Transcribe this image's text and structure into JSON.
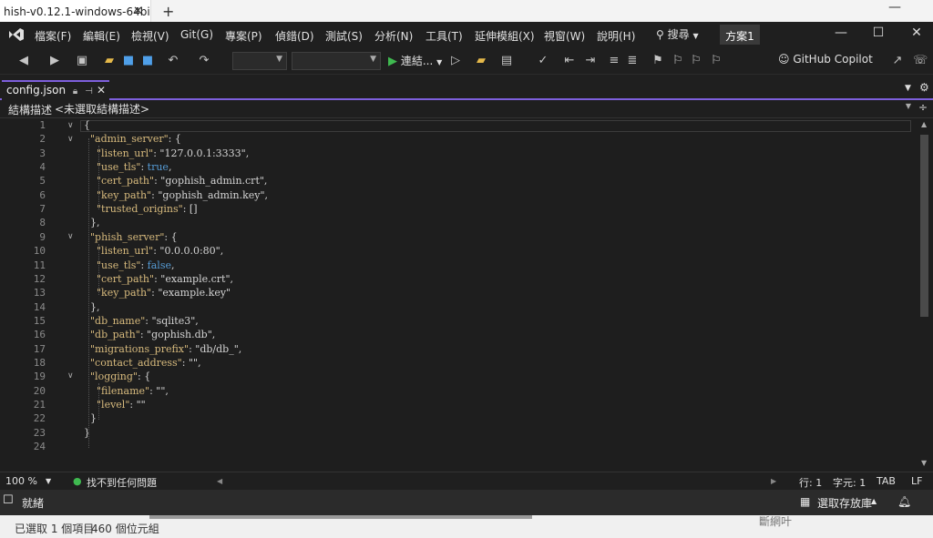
{
  "window": {
    "tab_title": "hish-v0.12.1-windows-64bi"
  },
  "menu": [
    "檔案(F)",
    "編輯(E)",
    "檢視(V)",
    "Git(G)",
    "專案(P)",
    "偵錯(D)",
    "測試(S)",
    "分析(N)",
    "工具(T)",
    "延伸模組(X)",
    "視窗(W)",
    "說明(H)"
  ],
  "search_label": "搜尋",
  "solution_label": "方案1",
  "toolbar": {
    "run_label": "連結...",
    "copilot_label": "GitHub Copilot"
  },
  "doc_tab": {
    "filename": "config.json"
  },
  "navbar": {
    "label": "結構描述:",
    "value": "<未選取結構描述>"
  },
  "editor": {
    "line_numbers": [
      "1",
      "2",
      "3",
      "4",
      "5",
      "6",
      "7",
      "8",
      "9",
      "10",
      "11",
      "12",
      "13",
      "14",
      "15",
      "16",
      "17",
      "18",
      "19",
      "20",
      "21",
      "22",
      "23",
      "24"
    ],
    "lines": [
      "{",
      "  \"admin_server\": {",
      "    \"listen_url\": \"127.0.0.1:3333\",",
      "    \"use_tls\": true,",
      "    \"cert_path\": \"gophish_admin.crt\",",
      "    \"key_path\": \"gophish_admin.key\",",
      "    \"trusted_origins\": []",
      "  },",
      "  \"phish_server\": {",
      "    \"listen_url\": \"0.0.0.0:80\",",
      "    \"use_tls\": false,",
      "    \"cert_path\": \"example.crt\",",
      "    \"key_path\": \"example.key\"",
      "  },",
      "  \"db_name\": \"sqlite3\",",
      "  \"db_path\": \"gophish.db\",",
      "  \"migrations_prefix\": \"db/db_\",",
      "  \"contact_address\": \"\",",
      "  \"logging\": {",
      "    \"filename\": \"\",",
      "    \"level\": \"\"",
      "  }",
      "}",
      ""
    ]
  },
  "editor_status": {
    "zoom": "100 %",
    "issues": "找不到任何問題",
    "line": "行: 1",
    "col": "字元: 1",
    "indent": "TAB",
    "eol": "LF"
  },
  "status_bar": {
    "ready": "就緒",
    "source_control": "選取存放庫"
  },
  "explorer": {
    "selected": "已選取 1 個項目",
    "size": "460 個位元組",
    "edge": "斷網叶"
  }
}
